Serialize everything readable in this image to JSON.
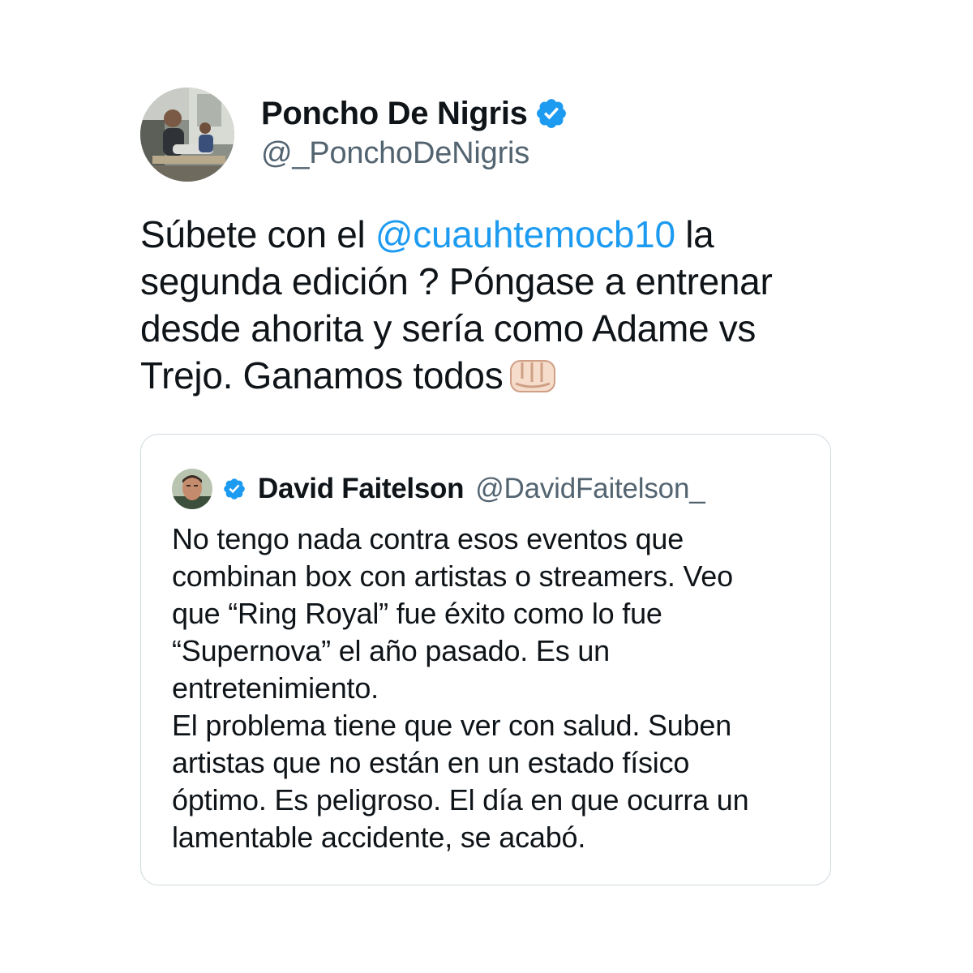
{
  "tweet": {
    "author": {
      "display_name": "Poncho De Nigris",
      "handle": "@_PonchoDeNigris",
      "verified": true,
      "avatar_icon": "profile-photo"
    },
    "text_lines": [
      {
        "before": "Súbete con el ",
        "mention": "@cuauhtemocb10",
        "after": "  la"
      },
      {
        "text": "segunda edición ? Póngase a entrenar"
      },
      {
        "text": "desde ahorita y sería como Adame vs"
      },
      {
        "text": "Trejo. Ganamos todos"
      }
    ],
    "emoji": "fist-bump-icon"
  },
  "quoted_tweet": {
    "author": {
      "display_name": "David Faitelson",
      "handle": "@DavidFaitelson_",
      "verified": true,
      "avatar_icon": "profile-photo"
    },
    "text_lines": [
      "No tengo nada contra esos eventos que",
      "combinan box con artistas o streamers. Veo",
      "que “Ring Royal” fue éxito como lo fue",
      "“Supernova” el año pasado. Es un",
      "entretenimiento.",
      "El problema tiene que ver con salud. Suben",
      "artistas que no están en un estado físico",
      "óptimo. Es peligroso. El día en que ocurra un",
      "lamentable accidente, se acabó."
    ]
  },
  "colors": {
    "text_primary": "#0f1419",
    "text_secondary": "#536471",
    "accent": "#1d9bf0",
    "border": "#cfd9de",
    "background": "#ffffff"
  }
}
